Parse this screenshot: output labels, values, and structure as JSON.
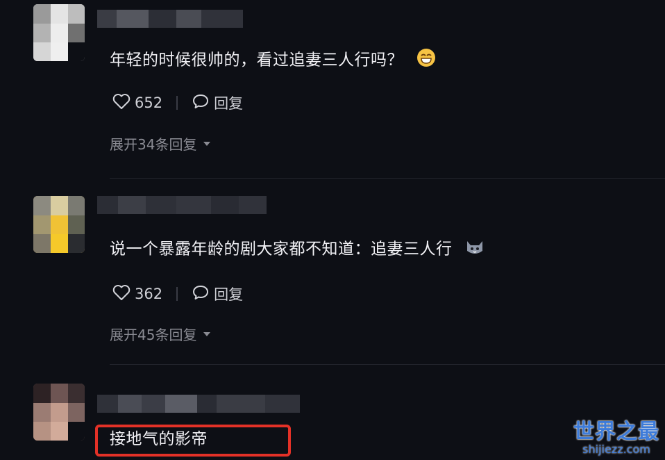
{
  "comments": [
    {
      "text": "年轻的时候很帅的，看过追妻三人行吗？",
      "emoji": "grinning-face-emoji",
      "likes": "652",
      "reply_label": "回复",
      "expand_label": "展开34条回复"
    },
    {
      "text": "说一个暴露年龄的剧大家都不知道：追妻三人行",
      "emoji": "cat-face-emoji",
      "likes": "362",
      "reply_label": "回复",
      "expand_label": "展开45条回复"
    },
    {
      "text": "接地气的影帝"
    }
  ],
  "watermark": {
    "title": "世界之最",
    "url": "shijiezz.com"
  },
  "colors": {
    "background": "#0d0f15",
    "highlight_border": "#e33127",
    "watermark": "#3d7bd9"
  }
}
